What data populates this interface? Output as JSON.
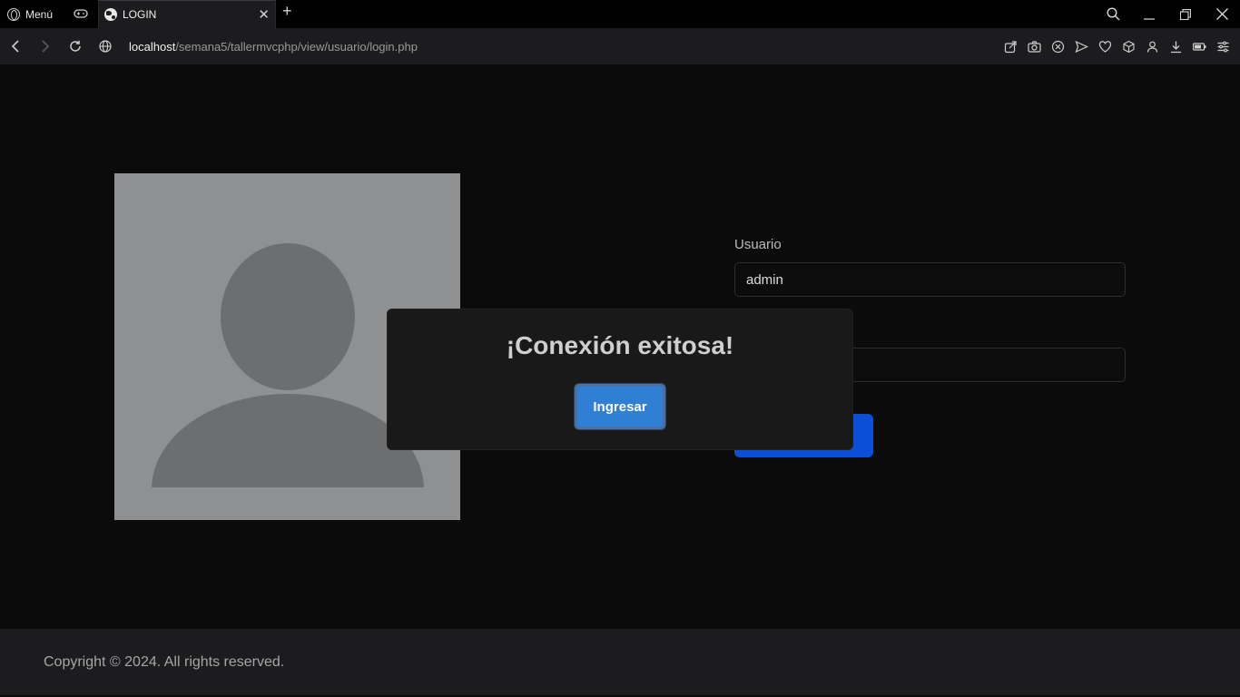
{
  "browser": {
    "menu_label": "Menú",
    "tab": {
      "title": "LOGIN"
    },
    "url": {
      "host": "localhost",
      "path": "/semana5/tallermvcphp/view/usuario/login.php"
    }
  },
  "form": {
    "usuario_label": "Usuario",
    "usuario_value": "admin",
    "password_value": ""
  },
  "modal": {
    "title": "¡Conexión exitosa!",
    "button_label": "Ingresar"
  },
  "footer": {
    "text": "Copyright © 2024. All rights reserved."
  },
  "colors": {
    "modal_button": "#2f7fd4",
    "submit_button": "#0b4fd6",
    "avatar_bg": "#8f9091"
  }
}
